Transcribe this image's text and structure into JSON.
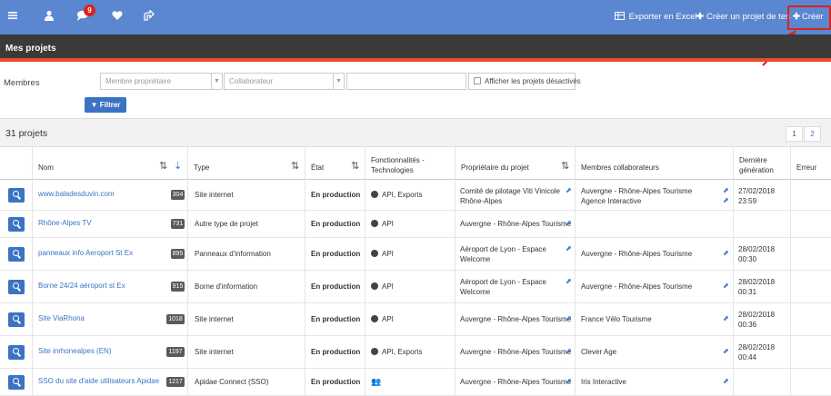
{
  "topbar": {
    "icons": [
      {
        "name": "menu-icon",
        "glyph": "≡"
      },
      {
        "name": "user-icon",
        "glyph": "●"
      },
      {
        "name": "chat-icon",
        "glyph": "●"
      },
      {
        "name": "heart-icon",
        "glyph": "♥"
      },
      {
        "name": "share-icon",
        "glyph": "↷"
      }
    ],
    "notification_count": "9",
    "export_label": "Exporter en Excel",
    "create_test_label": "Créer un projet de tes",
    "create_label": "Créer"
  },
  "page_title": "Mes projets",
  "filters": {
    "label": "Membres",
    "owner_placeholder": "Membre propriétaire",
    "collab_placeholder": "Collaborateur",
    "show_disabled_label": "Afficher les projets désactivés",
    "filter_button": "Filtrer"
  },
  "count_label": "31 projets",
  "pagination": [
    "1",
    "2"
  ],
  "columns": {
    "nom": "Nom",
    "type": "Type",
    "etat": "État",
    "fonct1": "Fonctionnalités -",
    "fonct2": "Technologies",
    "proprietaire": "Propriétaire du projet",
    "membres": "Membres collaborateurs",
    "derniere1": "Dernière",
    "derniere2": "génération",
    "erreur": "Erreur"
  },
  "rows": [
    {
      "name": "www.baladesduvin.com",
      "id": "304",
      "type": "Site internet",
      "state": "En production",
      "tech": "API, Exports",
      "tech_icon": "globe",
      "owner1": "Comité de pilotage Viti Vinicole",
      "owner2": "Rhône-Alpes",
      "members": [
        "Auvergne - Rhône-Alpes Tourisme",
        "Agence Interactive"
      ],
      "date1": "27/02/2018",
      "date2": "23:59"
    },
    {
      "name": "Rhône-Alpes TV",
      "id": "731",
      "type": "Autre type de projet",
      "state": "En production",
      "tech": "API",
      "tech_icon": "globe",
      "owner1": "Auvergne - Rhône-Alpes Tourisme",
      "owner2": "",
      "members": [],
      "date1": "",
      "date2": ""
    },
    {
      "name": "panneaux info Aeroport St Ex",
      "id": "895",
      "type": "Panneaux d'information",
      "state": "En production",
      "tech": "API",
      "tech_icon": "globe",
      "owner1": "Aéroport de Lyon - Espace",
      "owner2": "Welcome",
      "members": [
        "Auvergne - Rhône-Alpes Tourisme"
      ],
      "date1": "28/02/2018",
      "date2": "00:30"
    },
    {
      "name": "Borne 24/24 aéroport st Ex",
      "id": "915",
      "type": "Borne d'information",
      "state": "En production",
      "tech": "API",
      "tech_icon": "globe",
      "owner1": "Aéroport de Lyon - Espace",
      "owner2": "Welcome",
      "members": [
        "Auvergne - Rhône-Alpes Tourisme"
      ],
      "date1": "28/02/2018",
      "date2": "00:31"
    },
    {
      "name": "Site ViaRhona",
      "id": "1018",
      "type": "Site internet",
      "state": "En production",
      "tech": "API",
      "tech_icon": "globe",
      "owner1": "Auvergne - Rhône-Alpes Tourisme",
      "owner2": "",
      "members": [
        "France Vélo Tourisme"
      ],
      "date1": "28/02/2018",
      "date2": "00:36"
    },
    {
      "name": "Site inrhonealpes (EN)",
      "id": "1197",
      "type": "Site internet",
      "state": "En production",
      "tech": "API, Exports",
      "tech_icon": "globe",
      "owner1": "Auvergne - Rhône-Alpes Tourisme",
      "owner2": "",
      "members": [
        "Clever Age"
      ],
      "date1": "28/02/2018",
      "date2": "00:44"
    },
    {
      "name": "SSO du site d'aide utilisateurs Apidae",
      "id": "1217",
      "type": "Apidae Connect (SSO)",
      "state": "En production",
      "tech": "",
      "tech_icon": "people",
      "owner1": "Auvergne - Rhône-Alpes Tourisme",
      "owner2": "",
      "members": [
        "Iris Interactive"
      ],
      "date1": "",
      "date2": ""
    }
  ],
  "colors": {
    "topbar": "#5b86d0",
    "titlebar": "#3a3a3a",
    "accent": "#e64e2b",
    "link": "#3b73c4",
    "highlight": "#d9241b"
  }
}
